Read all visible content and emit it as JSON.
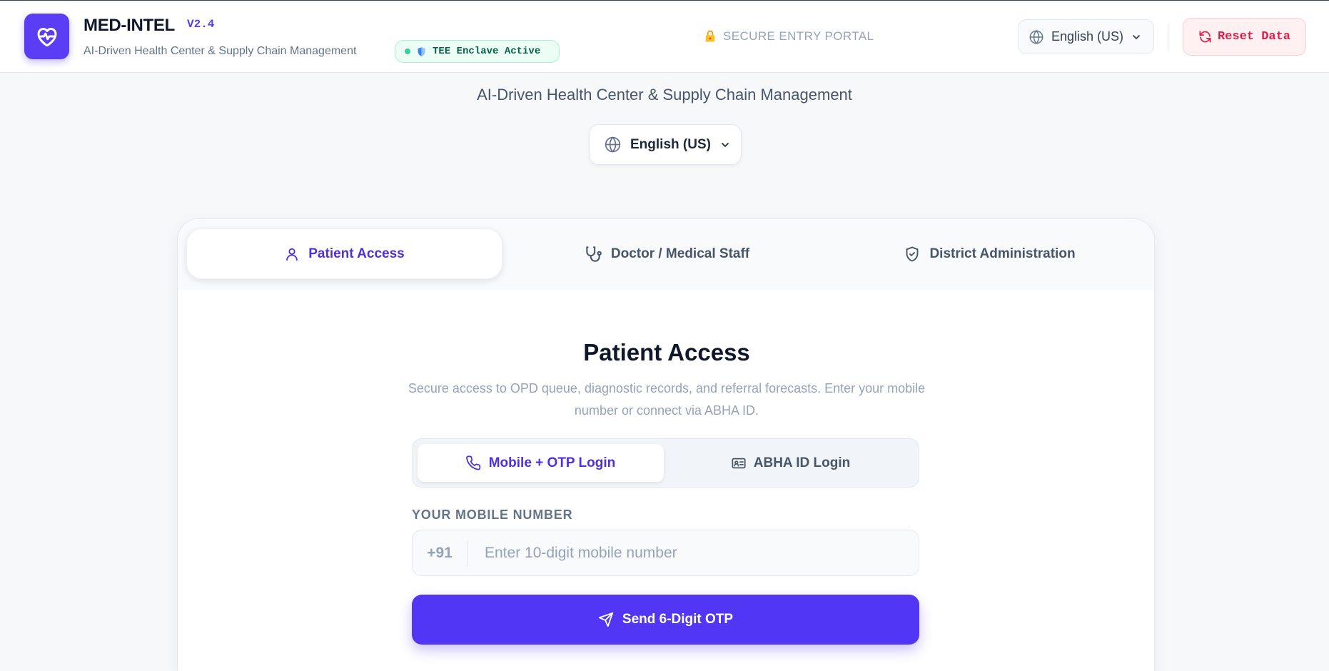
{
  "header": {
    "title": "MED-INTEL",
    "version": "V2.4",
    "subtitle": "AI-Driven Health Center & Supply Chain Management",
    "tee_status": "TEE Enclave Active",
    "portal_label": "SECURE ENTRY PORTAL",
    "language": "English (US)",
    "reset_label": "Reset Data"
  },
  "page": {
    "subtitle": "AI-Driven Health Center & Supply Chain Management",
    "language": "English (US)"
  },
  "role_tabs": [
    {
      "label": "Patient Access",
      "icon": "user-icon",
      "active": true
    },
    {
      "label": "Doctor / Medical Staff",
      "icon": "stethoscope-icon",
      "active": false
    },
    {
      "label": "District Administration",
      "icon": "shield-check-icon",
      "active": false
    }
  ],
  "card": {
    "title": "Patient Access",
    "description": "Secure access to OPD queue, diagnostic records, and referral forecasts. Enter your mobile number or connect via ABHA ID."
  },
  "login_methods": [
    {
      "label": "Mobile + OTP Login",
      "icon": "phone-icon",
      "active": true
    },
    {
      "label": "ABHA ID Login",
      "icon": "id-card-icon",
      "active": false
    }
  ],
  "form": {
    "mobile_label": "YOUR MOBILE NUMBER",
    "country_code": "+91",
    "mobile_placeholder": "Enter 10-digit mobile number",
    "mobile_value": "",
    "submit_label": "Send 6-Digit OTP"
  },
  "colors": {
    "accent": "#5236f5",
    "danger": "#e11d48",
    "success": "#34d399"
  }
}
